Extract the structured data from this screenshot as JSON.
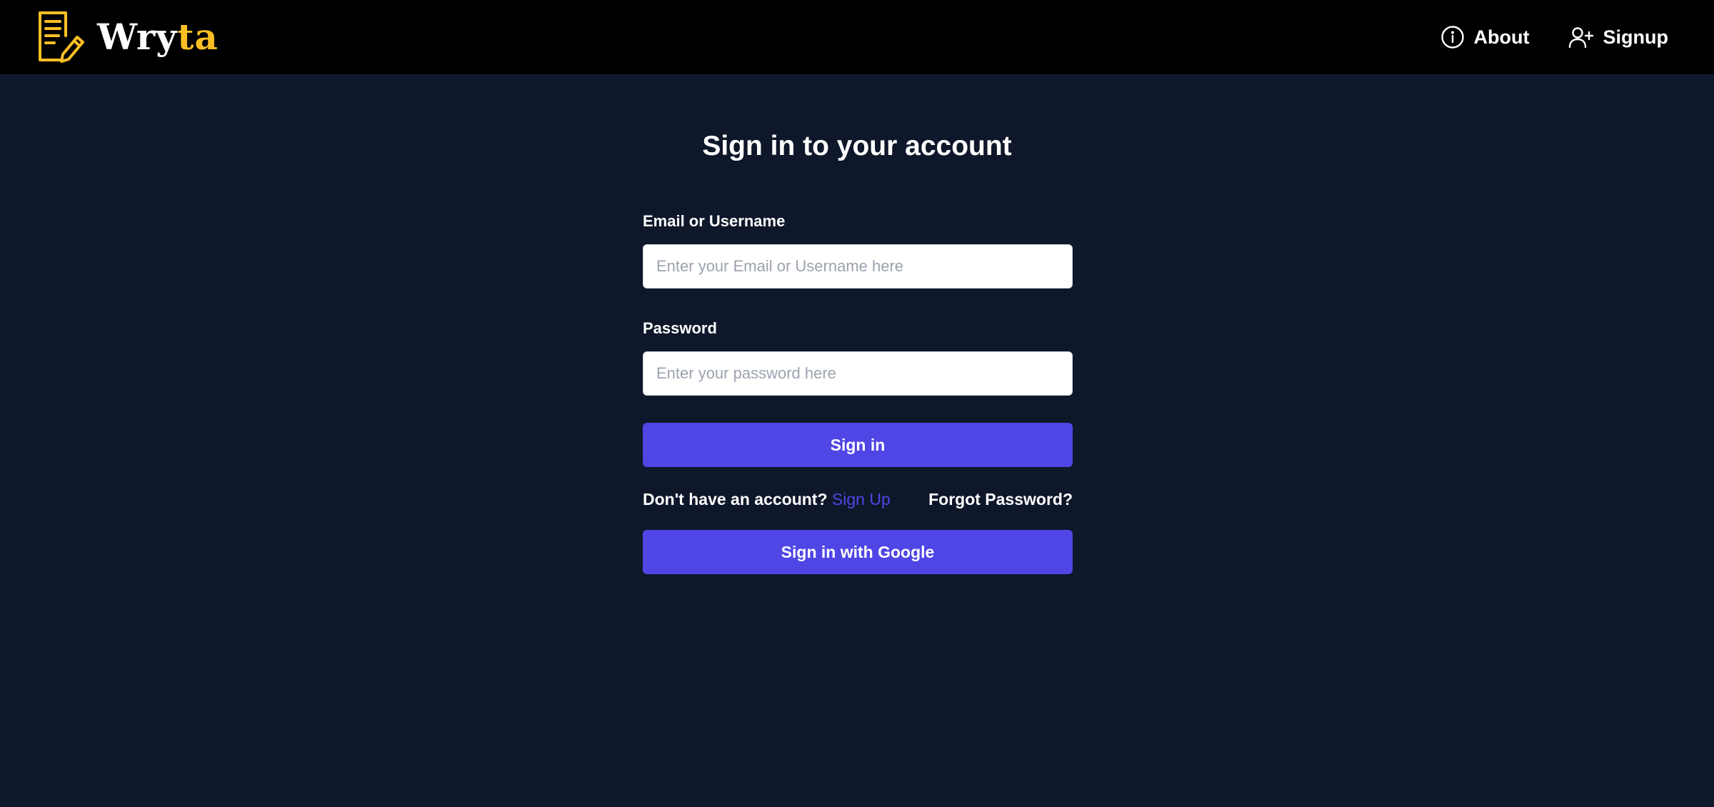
{
  "brand": {
    "name_part1": "Wry",
    "name_part2": "ta",
    "accent_color": "#fbbf24",
    "logo_icon": "notepad-pencil-icon"
  },
  "nav": {
    "items": [
      {
        "label": "About",
        "icon": "info-circle-icon"
      },
      {
        "label": "Signup",
        "icon": "user-plus-icon"
      }
    ]
  },
  "form": {
    "heading": "Sign in to your account",
    "email": {
      "label": "Email or Username",
      "placeholder": "Enter your Email or Username here",
      "value": ""
    },
    "password": {
      "label": "Password",
      "placeholder": "Enter your password here",
      "value": ""
    },
    "submit_label": "Sign in",
    "no_account_text": "Don't have an account?",
    "signup_link": "Sign Up",
    "forgot_link": "Forgot Password?",
    "google_label": "Sign in with Google"
  },
  "colors": {
    "page_background": "#0f172a",
    "navbar_background": "#000000",
    "primary": "#4f46e5",
    "text": "#ffffff"
  }
}
